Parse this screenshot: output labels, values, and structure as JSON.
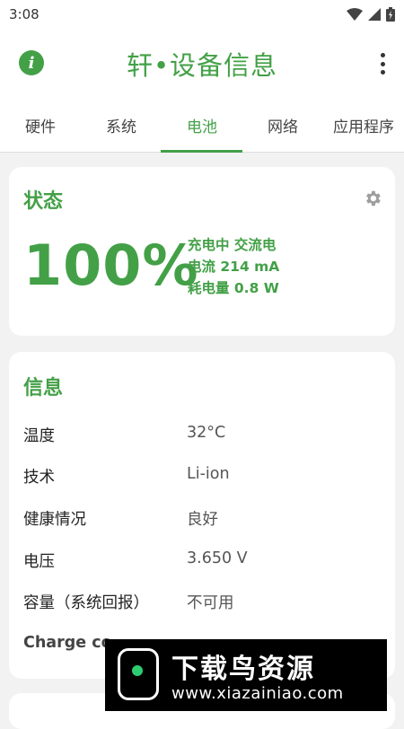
{
  "status_bar": {
    "time": "3:08"
  },
  "app_bar": {
    "title": "轩•设备信息"
  },
  "tabs": [
    {
      "label": "硬件"
    },
    {
      "label": "系统"
    },
    {
      "label": "电池"
    },
    {
      "label": "网络"
    },
    {
      "label": "应用程序"
    }
  ],
  "active_tab": "电池",
  "status_card": {
    "title": "状态",
    "percent": "100%",
    "lines": [
      "充电中 交流电",
      "电流 214 mA",
      "耗电量 0.8 W"
    ]
  },
  "info_card": {
    "title": "信息",
    "rows": [
      {
        "label": "温度",
        "value": "32°C"
      },
      {
        "label": "技术",
        "value": "Li-ion"
      },
      {
        "label": "健康情况",
        "value": "良好"
      },
      {
        "label": "电压",
        "value": "3.650 V"
      },
      {
        "label": "容量（系统回报）",
        "value": "不可用"
      },
      {
        "label": "Charge co",
        "value": ""
      }
    ]
  },
  "watermark": {
    "title": "下载鸟资源",
    "url": "www.xiazainiao.com"
  },
  "colors": {
    "accent": "#43a047",
    "background": "#f2f2f2",
    "card": "#ffffff"
  }
}
